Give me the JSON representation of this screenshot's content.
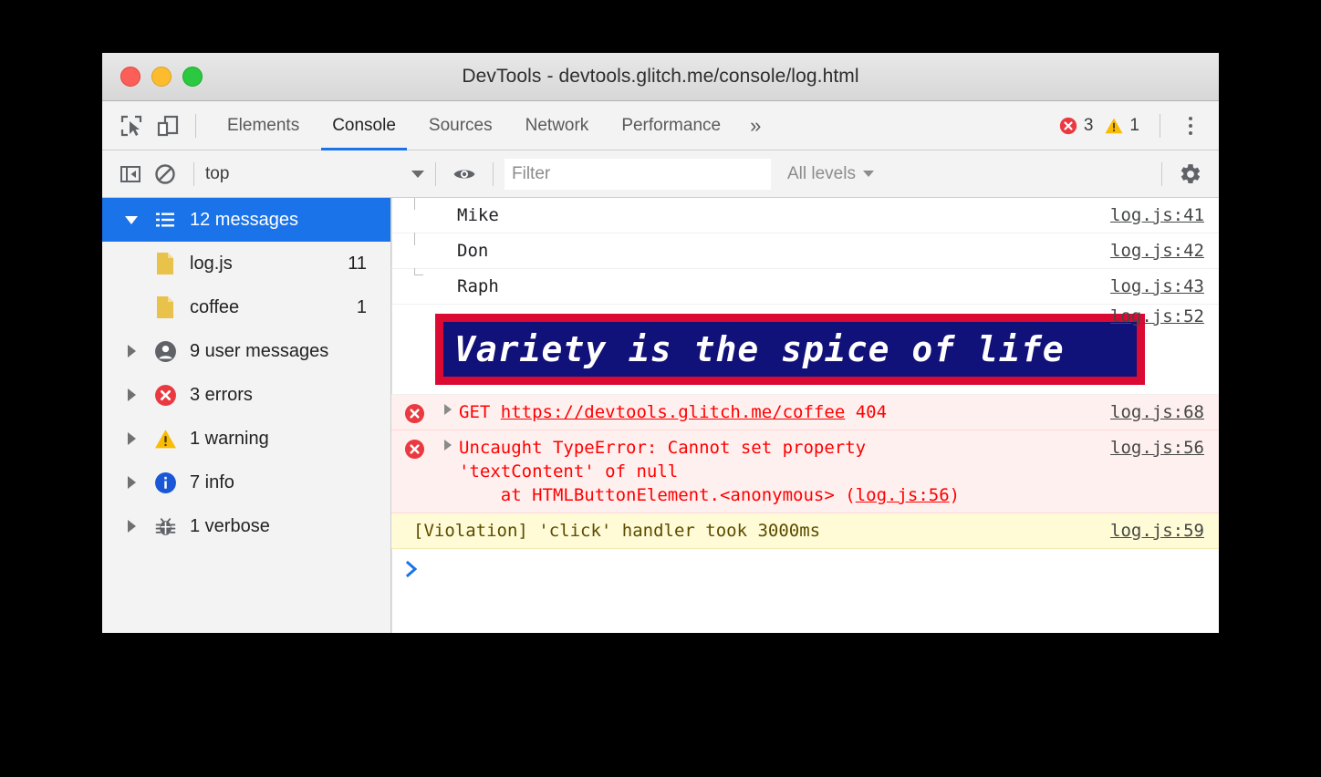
{
  "window": {
    "title": "DevTools - devtools.glitch.me/console/log.html",
    "traffic_lights": [
      "close-red",
      "minimize-yellow",
      "maximize-green"
    ]
  },
  "tabbar": {
    "inspect_icon": "inspect-element-icon",
    "device_icon": "device-toolbar-icon",
    "tabs": [
      {
        "label": "Elements",
        "active": false
      },
      {
        "label": "Console",
        "active": true
      },
      {
        "label": "Sources",
        "active": false
      },
      {
        "label": "Network",
        "active": false
      },
      {
        "label": "Performance",
        "active": false
      }
    ],
    "overflow_label": "»",
    "error_count": "3",
    "warning_count": "1",
    "menu_icon": "more-vertical-icon"
  },
  "console_toolbar": {
    "sidebar_toggle_icon": "sidebar-toggle-icon",
    "clear_icon": "clear-console-icon",
    "context": "top",
    "eye_icon": "live-expression-eye-icon",
    "filter_placeholder": "Filter",
    "filter_value": "",
    "levels_label": "All levels",
    "settings_icon": "gear-icon"
  },
  "sidebar": {
    "root": {
      "label": "12 messages",
      "icon": "list-icon",
      "selected": true,
      "expanded": true
    },
    "children": [
      {
        "label": "log.js",
        "count": "11",
        "icon": "file-icon"
      },
      {
        "label": "coffee",
        "count": "1",
        "icon": "file-icon"
      }
    ],
    "groups": [
      {
        "label": "9 user messages",
        "icon": "user-icon"
      },
      {
        "label": "3 errors",
        "icon": "error-icon"
      },
      {
        "label": "1 warning",
        "icon": "warning-icon"
      },
      {
        "label": "7 info",
        "icon": "info-icon"
      },
      {
        "label": "1 verbose",
        "icon": "bug-icon"
      }
    ]
  },
  "messages": [
    {
      "type": "log-grouped",
      "text": "Mike",
      "source": "log.js:41"
    },
    {
      "type": "log-grouped",
      "text": "Don",
      "source": "log.js:42"
    },
    {
      "type": "log-grouped-last",
      "text": "Raph",
      "source": "log.js:43"
    },
    {
      "type": "styled",
      "text": "Variety is the spice of life",
      "source": "log.js:52",
      "box_border_color": "#db0a33",
      "box_background_color": "#11117a",
      "text_color": "#ffffff"
    },
    {
      "type": "error",
      "icon": "error-icon",
      "text_parts": [
        "GET ",
        "https://devtools.glitch.me/coffee",
        " 404"
      ],
      "link_text": "https://devtools.glitch.me/coffee",
      "prefix": "GET ",
      "suffix": " 404",
      "source": "log.js:68"
    },
    {
      "type": "error-stack",
      "icon": "error-icon",
      "line1": "Uncaught TypeError: Cannot set property",
      "line2": "'textContent' of null",
      "line3_prefix": "    at HTMLButtonElement.<anonymous> (",
      "line3_link": "log.js:56",
      "line3_suffix": ")",
      "source": "log.js:56"
    },
    {
      "type": "violation",
      "text": "[Violation] 'click' handler took 3000ms",
      "source": "log.js:59"
    }
  ],
  "prompt": {
    "chevron": ">",
    "value": ""
  },
  "colors": {
    "accent_blue": "#1a73e8",
    "error_red": "#ff0000",
    "error_bg": "#fff0f0",
    "warning_bg": "#fffbd6",
    "warning_text": "#5c4b00",
    "sidebar_bg": "#f3f3f3"
  }
}
